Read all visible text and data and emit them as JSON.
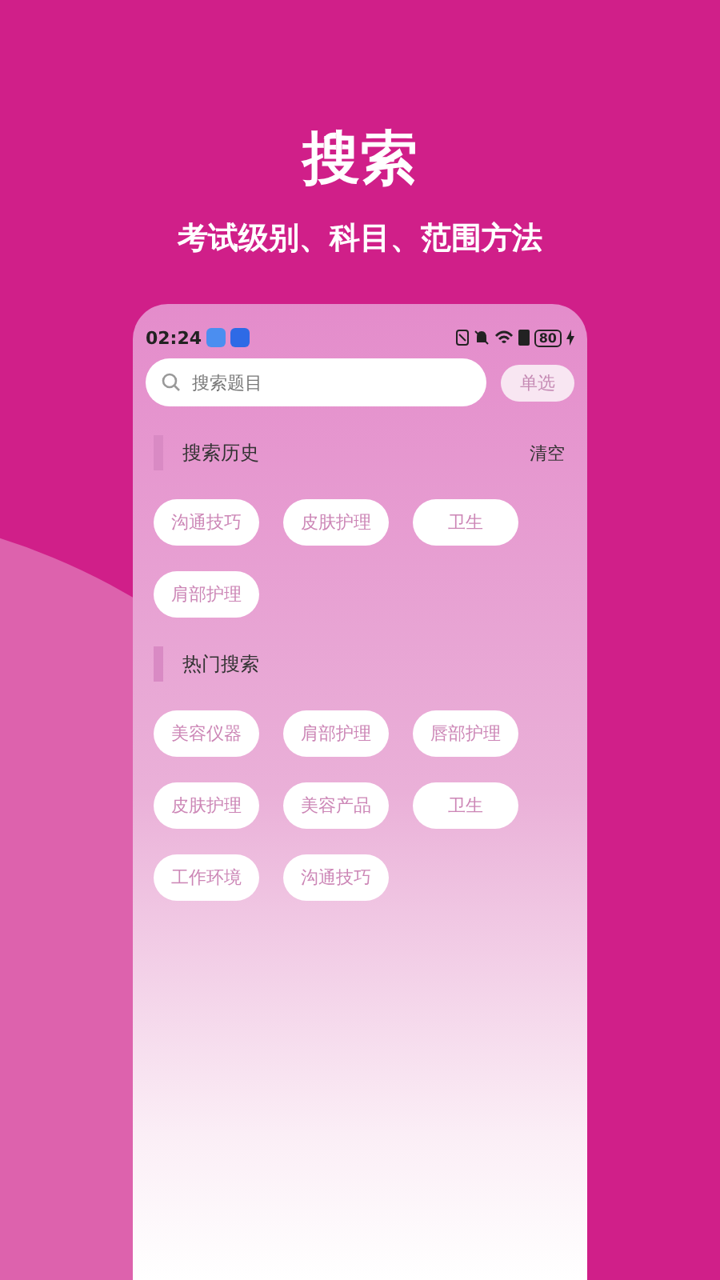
{
  "header": {
    "title": "搜索",
    "subtitle": "考试级别、科目、范围方法"
  },
  "status_bar": {
    "time": "02:24",
    "battery": "80"
  },
  "search": {
    "placeholder": "搜索题目",
    "button": "单选"
  },
  "history": {
    "title": "搜索历史",
    "action": "清空",
    "items": [
      "沟通技巧",
      "皮肤护理",
      "卫生",
      "肩部护理"
    ]
  },
  "hot": {
    "title": "热门搜索",
    "items": [
      "美容仪器",
      "肩部护理",
      "唇部护理",
      "皮肤护理",
      "美容产品",
      "卫生",
      "工作环境",
      "沟通技巧"
    ]
  }
}
